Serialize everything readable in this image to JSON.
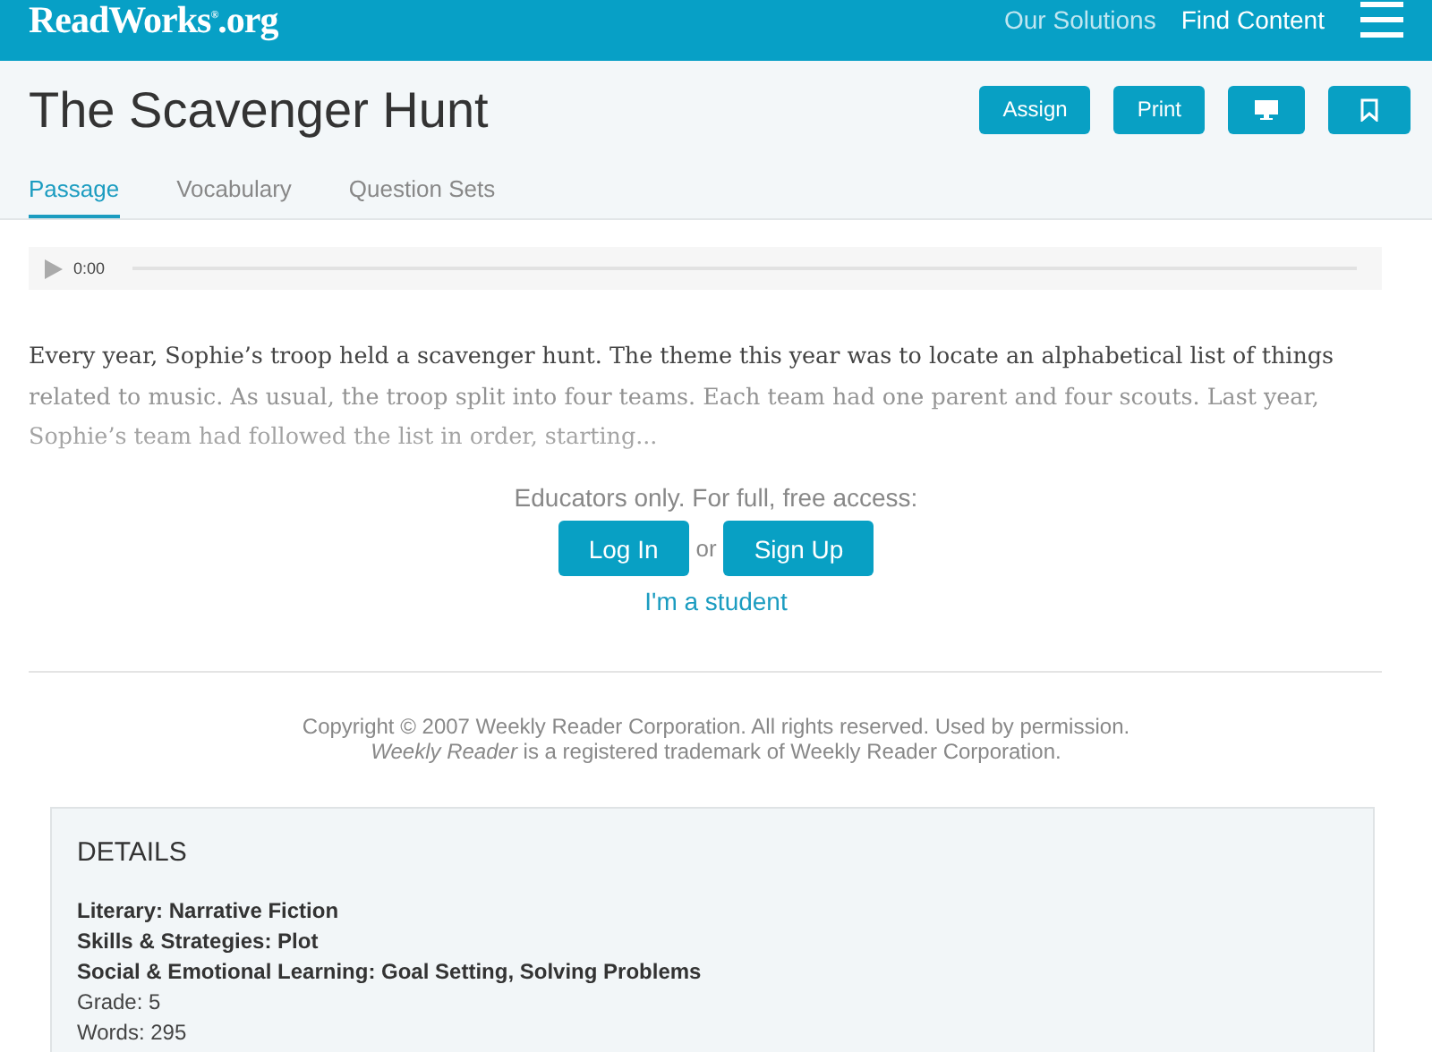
{
  "header": {
    "logo": "ReadWorks",
    "logo_mark": "®",
    "logo_suffix": ".org",
    "nav": [
      "Our Solutions",
      "Find Content"
    ]
  },
  "title": "The Scavenger Hunt",
  "actions": [
    {
      "kind": "text",
      "label": "Assign"
    },
    {
      "kind": "text",
      "label": "Print"
    },
    {
      "kind": "monitor"
    },
    {
      "kind": "bookmark"
    }
  ],
  "tabs": [
    {
      "label": "Passage",
      "selected": true
    },
    {
      "label": "Vocabulary",
      "selected": false
    },
    {
      "label": "Question Sets",
      "selected": false
    }
  ],
  "audio": {
    "time": "0:00"
  },
  "passage": "Every year, Sophie’s troop held a scavenger hunt. The theme this year was to locate an alphabetical list of things related to music. As usual, the troop split into four teams. Each team had one parent and four scouts. Last year, Sophie’s team had followed the list in order, starting...",
  "access": {
    "prompt": "Educators only. For full, free access:",
    "login": "Log In",
    "or": "or",
    "signup": "Sign Up",
    "student": "I'm a student"
  },
  "copyright": [
    "Copyright © 2007 Weekly Reader Corporation. All rights reserved. Used by permission.",
    "*Weekly Reader* is a registered trademark of Weekly Reader Corporation."
  ],
  "details": {
    "heading": "DETAILS",
    "items": [
      {
        "kind": "bold",
        "text": "Literary: Narrative Fiction"
      },
      {
        "kind": "bold",
        "text": "Skills & Strategies: Plot"
      },
      {
        "kind": "bold",
        "text": "Social & Emotional Learning: Goal Setting, Solving Problems"
      },
      {
        "kind": "plain",
        "text": "Grade: 5"
      },
      {
        "kind": "plain",
        "text": "Words: 295"
      }
    ]
  }
}
